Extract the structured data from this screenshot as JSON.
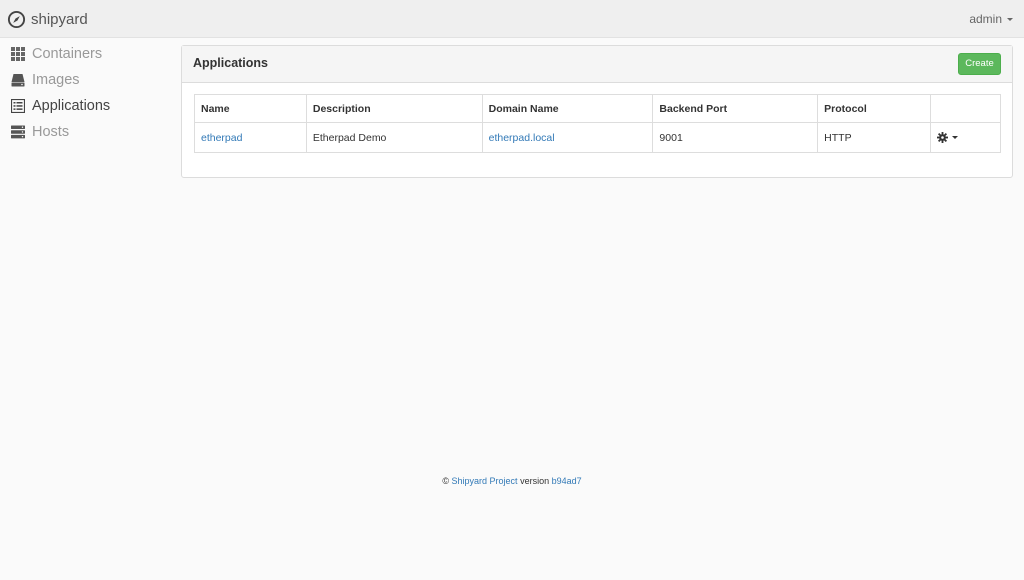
{
  "navbar": {
    "brand": "shipyard",
    "user": "admin"
  },
  "sidebar": {
    "items": [
      {
        "label": "Containers",
        "icon": "grid-icon",
        "active": false
      },
      {
        "label": "Images",
        "icon": "hdd-icon",
        "active": false
      },
      {
        "label": "Applications",
        "icon": "list-alt-icon",
        "active": true
      },
      {
        "label": "Hosts",
        "icon": "server-icon",
        "active": false
      }
    ]
  },
  "panel": {
    "title": "Applications",
    "create_label": "Create"
  },
  "table": {
    "headers": [
      "Name",
      "Description",
      "Domain Name",
      "Backend Port",
      "Protocol",
      ""
    ],
    "rows": [
      {
        "name": "etherpad",
        "description": "Etherpad Demo",
        "domain": "etherpad.local",
        "port": "9001",
        "protocol": "HTTP",
        "actions_icon": "gear-icon"
      }
    ]
  },
  "footer": {
    "copyright": "©",
    "project_link": "Shipyard Project",
    "version_label": "version",
    "version": "b94ad7"
  },
  "colors": {
    "accent_link": "#337ab7",
    "create_button": "#5cb85c",
    "navbar_bg": "#efefef"
  }
}
